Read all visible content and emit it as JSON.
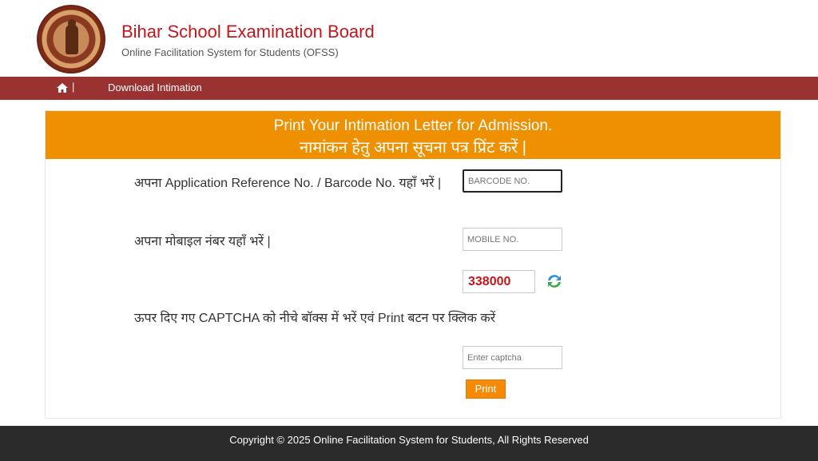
{
  "header": {
    "title": "Bihar School Examination Board",
    "subtitle": "Online Facilitation System for Students (OFSS)"
  },
  "nav": {
    "home_icon": "home-icon",
    "separator": "|",
    "link": "Download Intimation"
  },
  "panel": {
    "heading_en": "Print Your Intimation Letter for Admission.",
    "heading_hi": "नामांकन हेतु अपना सूचना पत्र प्रिंट करें |",
    "barcode_label": "अपना Application Reference No. / Barcode No. यहाँ भरें |",
    "barcode_placeholder": "BARCODE NO.",
    "mobile_label": "अपना मोबाइल नंबर यहाँ भरें |",
    "mobile_placeholder": "MOBILE NO.",
    "captcha_value": "338000",
    "refresh_icon": "refresh-icon",
    "captcha_instruction": "ऊपर दिए गए CAPTCHA को नीचे बॉक्स में भरें एवं Print बटन पर क्लिक करें",
    "captcha_placeholder": "Enter captcha",
    "print_label": "Print"
  },
  "footer": {
    "copyright": "Copyright © 2025 Online Facilitation System for Students, All Rights Reserved"
  },
  "colors": {
    "brand_red": "#c4161c",
    "navbar": "#9b3232",
    "panel_header": "#ee9000",
    "button": "#f58a07",
    "footer": "#2b2b2b"
  }
}
